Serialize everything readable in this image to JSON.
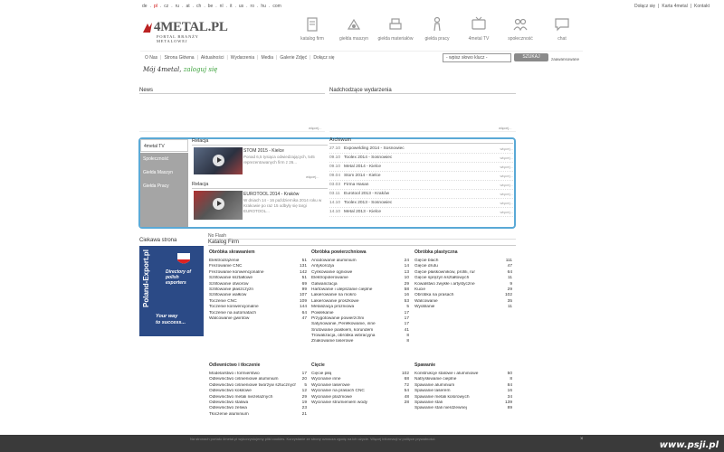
{
  "languages": [
    {
      "code": "de",
      "active": false
    },
    {
      "code": "pl",
      "active": true
    },
    {
      "code": "cz",
      "active": false
    },
    {
      "code": "ru",
      "active": false
    },
    {
      "code": "at",
      "active": false
    },
    {
      "code": "ch",
      "active": false
    },
    {
      "code": "be",
      "active": false
    },
    {
      "code": "nl",
      "active": false
    },
    {
      "code": "it",
      "active": false
    },
    {
      "code": "us",
      "active": false
    },
    {
      "code": "ro",
      "active": false
    },
    {
      "code": "hu",
      "active": false
    },
    {
      "code": "com",
      "active": false
    }
  ],
  "top_links": [
    "Dołącz się",
    "Karta 4metal",
    "Kontakt"
  ],
  "logo": {
    "word": "4METAL.PL",
    "sub": "PORTAL BRANŻY METALOWEJ"
  },
  "main_nav": [
    {
      "label": "katalog firm",
      "icon": "catalog-icon"
    },
    {
      "label": "giełda maszyn",
      "icon": "machine-market-icon"
    },
    {
      "label": "giełda materiałów",
      "icon": "materials-market-icon"
    },
    {
      "label": "giełda pracy",
      "icon": "job-market-icon"
    },
    {
      "label": "4metal TV",
      "icon": "tv-icon"
    },
    {
      "label": "społeczność",
      "icon": "community-icon"
    },
    {
      "label": "chat",
      "icon": "chat-icon"
    }
  ],
  "sub_nav": [
    "O Nas",
    "Strona Główna",
    "Aktualności",
    "Wydarzenia",
    "Media",
    "Galerie Zdjęć",
    "Dołącz się"
  ],
  "search": {
    "value": "- wpisz słowo klucz -",
    "button": "SZUKAJ",
    "advanced": "zaawansowane"
  },
  "handwriting": {
    "left": "Mój 4metal",
    "right": "zaloguj się"
  },
  "sections": {
    "news": "News",
    "events": "Nadchodzące wydarzenia",
    "more": "więcej..."
  },
  "tv_tabs": [
    "4metal TV",
    "Społeczność",
    "Giełda Maszyn",
    "Giełda Pracy"
  ],
  "relacje": [
    {
      "header": "Relacja",
      "title": "STOM 2015 - Kielce",
      "desc": "Ponad 6,5 tysiąca odwiedzających, 545 reprezentowanych firm z 26..."
    },
    {
      "header": "Relacja",
      "title": "EUROTOOL 2014 - Kraków",
      "desc": "W dniach 14 - 16 października 2014 roku w Krakowie po raz 15 odbyły się targi EUROTOOL..."
    }
  ],
  "archive": {
    "header": "Archiwum",
    "items": [
      {
        "date": "27.10",
        "name": "Expowelding 2014 - Sosnowiec"
      },
      {
        "date": "09.10",
        "name": "Toolex 2014 - Sosnowiec"
      },
      {
        "date": "09.10",
        "name": "Metal 2014 - Kielce"
      },
      {
        "date": "09.04",
        "name": "Stom 2014 - Kielce"
      },
      {
        "date": "03.03",
        "name": "Firma Hasan"
      },
      {
        "date": "03.11",
        "name": "Eurotool 2013 - Kraków"
      },
      {
        "date": "14.10",
        "name": "Toolex 2013 - Sosnowiec"
      },
      {
        "date": "14.10",
        "name": "Metal 2013 - Kielce"
      }
    ]
  },
  "ciekawa_strona": "Ciekawa strona",
  "poland_export": {
    "title": "Poland-Export.pl",
    "directory": [
      "Directory of",
      "polish",
      "exporters"
    ],
    "success": [
      "Your way",
      "to success..."
    ]
  },
  "no_flash": "No Flash",
  "katalog_firm": "Katalog Firm",
  "categories": [
    {
      "header": "Obróbka skrawaniem",
      "items": [
        [
          "Elektrodrążenie",
          "51"
        ],
        [
          "Frezowanie CNC",
          "131"
        ],
        [
          "Frezowanie konwencjonalne",
          "142"
        ],
        [
          "Szlifowanie kształtowe",
          "51"
        ],
        [
          "Szlifowanie otworów",
          "69"
        ],
        [
          "Szlifowanie płaszczyzn",
          "99"
        ],
        [
          "Szlifowanie wałków",
          "107"
        ],
        [
          "Toczenie CNC",
          "109"
        ],
        [
          "Toczenie konwencjonalne",
          "144"
        ],
        [
          "Toczenie na automatach",
          "64"
        ],
        [
          "Walcowanie gwintów",
          "47"
        ]
      ]
    },
    {
      "header": "Obróbka powierzchniowa",
      "items": [
        [
          "Anodowanie aluminium",
          "24"
        ],
        [
          "Antykorozja",
          "14"
        ],
        [
          "Cynkowanie ogniowe",
          "13"
        ],
        [
          "Elektropolerowanie",
          "10"
        ],
        [
          "Galwanizacja",
          "29"
        ],
        [
          "Hartowanie i ulepszanie cieplne",
          "58"
        ],
        [
          "Lakierowanie na mokro",
          "16"
        ],
        [
          "Lakierowanie proszkowe",
          "53"
        ],
        [
          "Metalizacja próżniowa",
          "5"
        ],
        [
          "Powlekanie",
          "17"
        ],
        [
          "Przygotowanie powierzchni",
          "17"
        ],
        [
          "Satynowanie, Perełkowanie, inne",
          "17"
        ],
        [
          "Śrutowanie piaskiem, korundem",
          "41"
        ],
        [
          "Trowalizacja, obróbka wibracyjna",
          "8"
        ],
        [
          "Znakowanie laserowe",
          "8"
        ]
      ]
    },
    {
      "header": "Obróbka plastyczna",
      "items": [
        [
          "Gięcie blach",
          "111"
        ],
        [
          "Gięcie drutu",
          "47"
        ],
        [
          "Gięcie płaskowników, profili, rur",
          "64"
        ],
        [
          "Gięcie sprężyn kształtowych",
          "11"
        ],
        [
          "Kowalstwo zwykłe i artystyczne",
          "9"
        ],
        [
          "Kucie",
          "29"
        ],
        [
          "Obróbka na prasach",
          "102"
        ],
        [
          "Walcowanie",
          "35"
        ],
        [
          "Wyoblanie",
          "11"
        ]
      ]
    },
    {
      "header": "Odlewnictwo i tłoczenie",
      "items": [
        [
          "Modelarstwo i formierstwo",
          "17"
        ],
        [
          "Odlewnictwo ciśnieniowe aluminium",
          "20"
        ],
        [
          "Odlewnictwo ciśnieniowe tworzyw sztucznych",
          "5"
        ],
        [
          "Odlewnictwo kokilowe",
          "12"
        ],
        [
          "Odlewnictwo metali nieżelaznych",
          "29"
        ],
        [
          "Odlewnictwo staliwa",
          "19"
        ],
        [
          "Odlewnictwo żeliwa",
          "23"
        ],
        [
          "Tłoczenie aluminium",
          "21"
        ]
      ]
    },
    {
      "header": "Cięcie",
      "items": [
        [
          "Cięcie piłą",
          "102"
        ],
        [
          "Wycinanie inne",
          "68"
        ],
        [
          "Wycinanie laserowe",
          "72"
        ],
        [
          "Wycinanie na prasach CNC",
          "54"
        ],
        [
          "Wycinanie plazmowe",
          "48"
        ],
        [
          "Wycinanie strumieniem wody",
          "28"
        ]
      ]
    },
    {
      "header": "Spawanie",
      "items": [
        [
          "Konstrukcje stalowe i aluminiowe",
          "50"
        ],
        [
          "Natryskiwanie cieplne",
          "8"
        ],
        [
          "Spawanie aluminium",
          "84"
        ],
        [
          "Spawanie laserem",
          "16"
        ],
        [
          "Spawanie metali kolorowych",
          "34"
        ],
        [
          "Spawanie stali",
          "139"
        ],
        [
          "Spawanie stali nierdzewnej",
          "89"
        ]
      ]
    }
  ],
  "footer": {
    "text": "Na stronach portalu 4metal.pl wykorzystujemy pliki cookies. Korzystanie ze strony oznacza zgodę na ich użycie. Więcej informacji w polityce prywatności.",
    "close": "×",
    "watermark": "www.psji.pl"
  },
  "colors": {
    "accent_blue": "#5aa9d6",
    "active_lang": "#cc0000",
    "green": "#3aa13a",
    "tab_gray": "#a5a5a5"
  }
}
